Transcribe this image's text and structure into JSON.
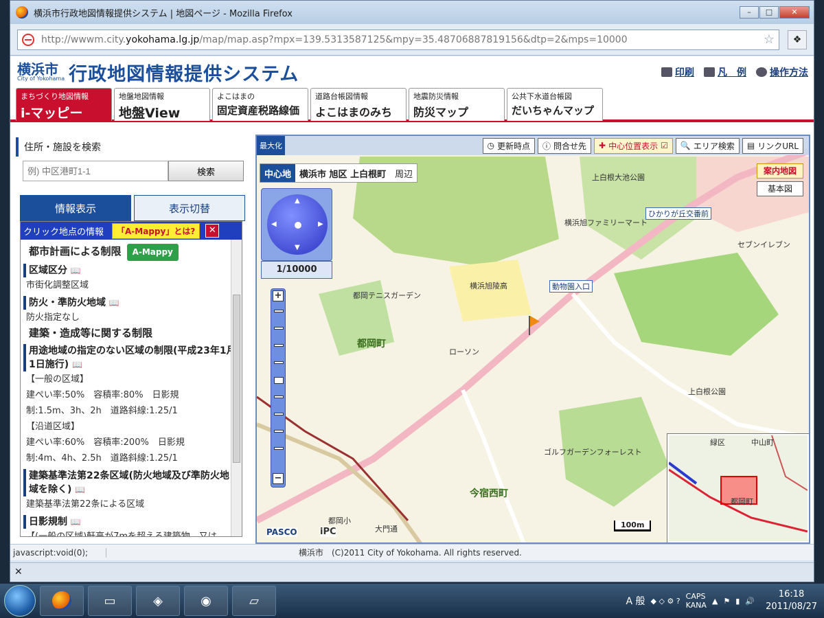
{
  "browser": {
    "title": "横浜市行政地図情報提供システム | 地図ページ - Mozilla Firefox",
    "url_prefix": "http://wwwm.city.",
    "url_host": "yokohama.lg.jp",
    "url_path": "/map/map.asp?mpx=139.5313587125&mpy=35.48706887819156&dtp=2&mps=10000",
    "controls": [
      "–",
      "□",
      "✕"
    ]
  },
  "site": {
    "logo_city": "横浜市",
    "logo_sub": "City of Yokohama",
    "logo_title": "行政地図情報提供システム",
    "links": {
      "print": "印刷",
      "legend": "凡　例",
      "help": "操作方法"
    }
  },
  "tabs": [
    {
      "sub": "まちづくり地図情報",
      "main": "i-マッピー"
    },
    {
      "sub": "地盤地図情報",
      "main": "地盤View"
    },
    {
      "sub": "よこはまの",
      "main": "固定資産税路線価"
    },
    {
      "sub": "道路台帳図情報",
      "main": "よこはまのみち"
    },
    {
      "sub": "地震防災情報",
      "main": "防災マップ"
    },
    {
      "sub": "公共下水道台帳図",
      "main": "だいちゃんマップ"
    }
  ],
  "search": {
    "label": "住所・施設を検索",
    "placeholder": "例) 中区港町1-1",
    "button": "検索"
  },
  "panel_tabs": {
    "info": "情報表示",
    "switch": "表示切替"
  },
  "info": {
    "header": "クリック地点の情報",
    "what_btn": "「A-Mappy」とは?",
    "close": "✕",
    "heading1": "都市計画による制限",
    "amappy": "A-Mappy",
    "sec1_title": "区域区分",
    "sec1_body": "市街化調整区域",
    "sec2_title": "防火・準防火地域",
    "sec2_body": "防火指定なし",
    "heading2": "建築・造成等に関する制限",
    "sec3_title": "用途地域の指定のない区域の制限(平成23年1月1日施行)",
    "sec3_lines": [
      "【一般の区域】",
      "建ぺい率:50%　容積率:80%　日影規",
      "制:1.5m、3h、2h　道路斜線:1.25/1",
      "【沿道区域】",
      "建ぺい率:60%　容積率:200%　日影規",
      "制:4m、4h、2.5h　道路斜線:1.25/1"
    ],
    "sec4_title": "建築基準法第22条区域(防火地域及び準防火地域を除く)",
    "sec4_body": "建築基準法第22条による区域",
    "sec5_title": "日影規制",
    "sec5_body": "【(一般の区域)軒高が7mを超える建築物、又は"
  },
  "map": {
    "maximize": "最大化",
    "toolbar": [
      "更新時点",
      "問合せ先",
      "中心位置表示",
      "エリア検索",
      "リンクURL"
    ],
    "center_tag": "中心地",
    "center_value": "横浜市 旭区 上白根町",
    "center_suffix": "周辺",
    "scale": "1/10000",
    "right_btns": {
      "guide": "案内地図",
      "base": "基本図"
    },
    "scale_bar": "100m",
    "credit1": "PASCO",
    "credit2": "iPC",
    "labels": [
      "上白根大池公園",
      "ひかりが丘交番前",
      "横浜旭ファミリーマート",
      "セブンイレブン",
      "横浜旭陵高",
      "動物園入口",
      "都岡テニスガーデン",
      "都岡町",
      "ローソン",
      "今宿西町",
      "ゴルフガーデンフォーレスト",
      "上白根公園",
      "都岡小",
      "大門通",
      "緑区",
      "中山町",
      "都岡町"
    ]
  },
  "status": {
    "left": "javascript:void(0);",
    "copyright": "横浜市　(C)2011 City of Yokohama. All rights reserved."
  },
  "addon": "✕",
  "taskbar": {
    "caps": "CAPS",
    "kana": "KANA",
    "ime": "A 般",
    "time": "16:18",
    "date": "2011/08/27"
  }
}
